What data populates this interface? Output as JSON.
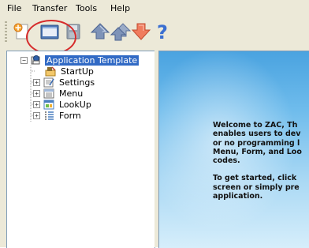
{
  "menu": {
    "items": [
      {
        "label": "File"
      },
      {
        "label": "Transfer"
      },
      {
        "label": "Tools"
      },
      {
        "label": "Help"
      }
    ]
  },
  "toolbar": {
    "buttons": [
      {
        "icon": "new-document-icon"
      },
      {
        "icon": "open-folder-icon"
      },
      {
        "icon": "save-disk-icon"
      },
      {
        "icon": "upload-arrow-icon"
      },
      {
        "icon": "upload-multiple-icon"
      },
      {
        "icon": "download-arrow-icon"
      },
      {
        "icon": "help-question-icon"
      }
    ]
  },
  "tree": {
    "root": {
      "label": "Application Template",
      "expanded": true,
      "selected": true
    },
    "children": [
      {
        "label": "StartUp",
        "expandable": false
      },
      {
        "label": "Settings",
        "expandable": true
      },
      {
        "label": "Menu",
        "expandable": true
      },
      {
        "label": "LookUp",
        "expandable": true
      },
      {
        "label": "Form",
        "expandable": true
      }
    ]
  },
  "welcome": {
    "paragraph1": "Welcome to ZAC, Th\nenables users to dev\nor no programming l\nMenu, Form, and Loo\ncodes.",
    "paragraph2": "To get started, click\nscreen or simply pre\napplication."
  },
  "colors": {
    "selection": "#316ac5",
    "annotation": "#d62b2b",
    "content_top": "#4aa3e0",
    "content_bottom": "#d6eefb"
  }
}
